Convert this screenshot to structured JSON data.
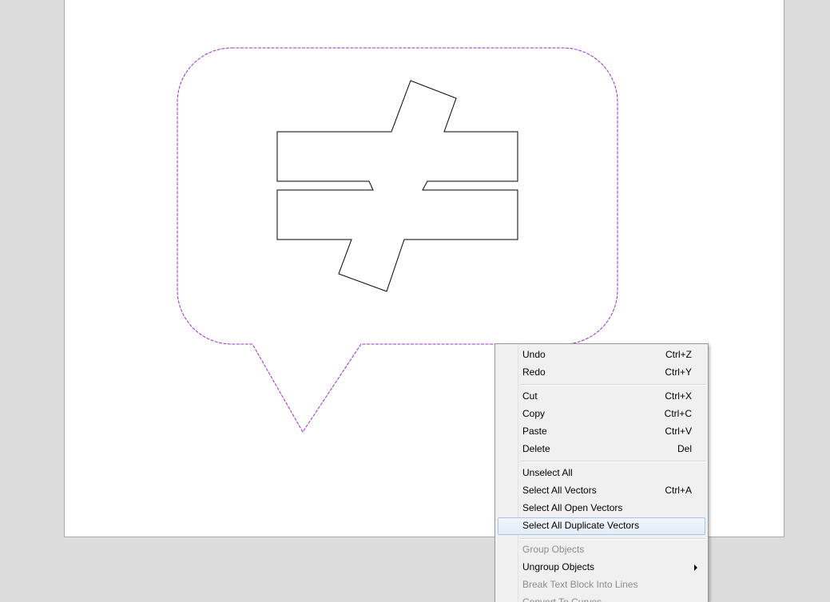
{
  "canvas": {
    "selection_color": "#9b30c8",
    "shape_stroke_color": "#000000",
    "objects": [
      "speech-bubble-vector",
      "not-equal-symbol-vector"
    ]
  },
  "context_menu": {
    "highlight_color": "#dde8f7",
    "items": [
      {
        "label": "Undo",
        "shortcut": "Ctrl+Z",
        "enabled": true
      },
      {
        "label": "Redo",
        "shortcut": "Ctrl+Y",
        "enabled": true
      },
      {
        "label": "Cut",
        "shortcut": "Ctrl+X",
        "enabled": true
      },
      {
        "label": "Copy",
        "shortcut": "Ctrl+C",
        "enabled": true
      },
      {
        "label": "Paste",
        "shortcut": "Ctrl+V",
        "enabled": true
      },
      {
        "label": "Delete",
        "shortcut": "Del",
        "enabled": true
      },
      {
        "label": "Unselect All",
        "shortcut": "",
        "enabled": true
      },
      {
        "label": "Select All Vectors",
        "shortcut": "Ctrl+A",
        "enabled": true
      },
      {
        "label": "Select All Open Vectors",
        "shortcut": "",
        "enabled": true
      },
      {
        "label": "Select All Duplicate Vectors",
        "shortcut": "",
        "enabled": true,
        "highlighted": true
      },
      {
        "label": "Group Objects",
        "shortcut": "",
        "enabled": false
      },
      {
        "label": "Ungroup Objects",
        "shortcut": "",
        "enabled": true,
        "submenu": true
      },
      {
        "label": "Break Text Block Into Lines",
        "shortcut": "",
        "enabled": false
      },
      {
        "label": "Convert To Curves",
        "shortcut": "",
        "enabled": false
      }
    ]
  }
}
